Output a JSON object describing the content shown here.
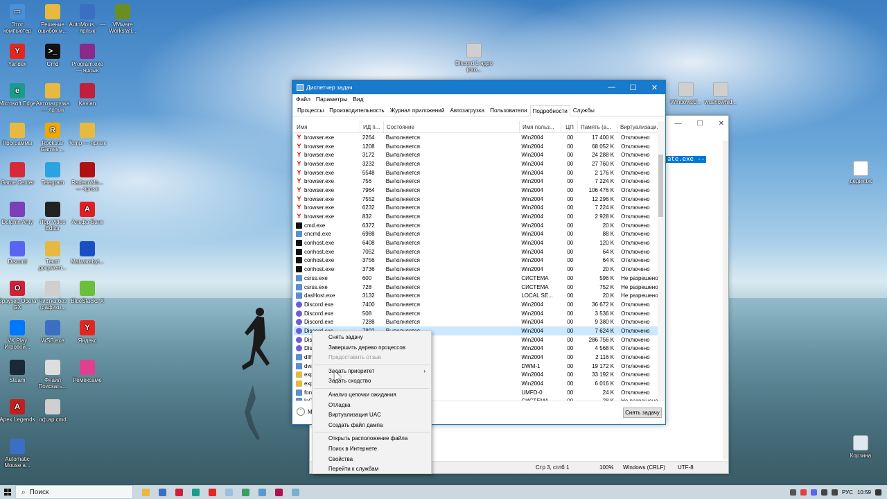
{
  "desktop_icons": [
    {
      "label": "Этот компьютер",
      "color": "#4a90d9",
      "glyph": "▭"
    },
    {
      "label": "Решение ошибок м...",
      "color": "#e8b940",
      "glyph": ""
    },
    {
      "label": "AutoMous... — ярлык",
      "color": "#3a6fc4",
      "glyph": ""
    },
    {
      "label": "VMware Workstati...",
      "color": "#6b8e23",
      "glyph": ""
    },
    {
      "label": "Yandex",
      "color": "#e52620",
      "glyph": "Y"
    },
    {
      "label": "Cmd",
      "color": "#111111",
      "glyph": ">_"
    },
    {
      "label": "Program.exe — ярлык",
      "color": "#8a2a8a",
      "glyph": ""
    },
    {
      "label": "Microsoft Edge",
      "color": "#1a9c8a",
      "glyph": "e"
    },
    {
      "label": "Автозагрузка — ярлык",
      "color": "#e8b940",
      "glyph": ""
    },
    {
      "label": "Kavian",
      "color": "#c0203a",
      "glyph": ""
    },
    {
      "label": "Программы",
      "color": "#e8b940",
      "glyph": ""
    },
    {
      "label": "Rockstar Games ...",
      "color": "#f0a800",
      "glyph": "R"
    },
    {
      "label": "Temp — ярлык",
      "color": "#e8b940",
      "glyph": ""
    },
    {
      "label": "Game Center",
      "color": "#d62a3a",
      "glyph": ""
    },
    {
      "label": "Telegram",
      "color": "#2aa3e0",
      "glyph": ""
    },
    {
      "label": "RadeonMo... — ярлык",
      "color": "#b01010",
      "glyph": ""
    },
    {
      "label": "Dolphin Anty",
      "color": "#7b3fb8",
      "glyph": ""
    },
    {
      "label": "iTop Video Editor",
      "color": "#222222",
      "glyph": ""
    },
    {
      "label": "Альфа-Банк",
      "color": "#e02020",
      "glyph": "A"
    },
    {
      "label": "Discord",
      "color": "#5865f2",
      "glyph": ""
    },
    {
      "label": "Текст документ...",
      "color": "#e8b940",
      "glyph": ""
    },
    {
      "label": "Malwarebyt...",
      "color": "#1a4fc4",
      "glyph": ""
    },
    {
      "label": "Браузер Opera GX",
      "color": "#d0203a",
      "glyph": "O"
    },
    {
      "label": "Чистка без графики...",
      "color": "#cfcfcf",
      "glyph": ""
    },
    {
      "label": "BlueStacks X",
      "color": "#6bbf3a",
      "glyph": ""
    },
    {
      "label": "VK Play Игровой...",
      "color": "#0077ff",
      "glyph": ""
    },
    {
      "label": "WSB.exe",
      "color": "#3a6fc4",
      "glyph": ""
    },
    {
      "label": "Яндекс",
      "color": "#e52620",
      "glyph": "Y"
    },
    {
      "label": "Steam",
      "color": "#1b2838",
      "glyph": ""
    },
    {
      "label": "Фнайл Поискать...",
      "color": "#dddddd",
      "glyph": ""
    },
    {
      "label": "Ремексаме",
      "color": "#e04090",
      "glyph": ""
    },
    {
      "label": "Apex Legends",
      "color": "#c02020",
      "glyph": "A"
    },
    {
      "label": "оф.ар.cmd",
      "color": "#cfcfcf",
      "glyph": ""
    },
    {
      "label": "Automatic Mouse a...",
      "color": "#3a6fc4",
      "glyph": ""
    }
  ],
  "right_icons": [
    {
      "label": "Discord 1 ядро (ско...",
      "color": "#cfcfcf"
    },
    {
      "label": "WindowsU...",
      "color": "#cfcfcf"
    },
    {
      "label": "wushowhid...",
      "color": "#cfcfcf"
    },
    {
      "label": "дедик.txt",
      "color": "#ffffff"
    },
    {
      "label": "Корзина",
      "color": "#dfe8ef"
    }
  ],
  "notepad": {
    "selected_text": "ate.exe --",
    "status": {
      "pos": "Стр 3, стлб 1",
      "zoom": "100%",
      "eol": "Windows (CRLF)",
      "enc": "UTF-8"
    }
  },
  "taskmgr": {
    "title": "Диспетчер задач",
    "menu": [
      "Файл",
      "Параметры",
      "Вид"
    ],
    "tabs": [
      "Процессы",
      "Производительность",
      "Журнал приложений",
      "Автозагрузка",
      "Пользователи",
      "Подробности",
      "Службы"
    ],
    "active_tab": "Подробности",
    "columns": {
      "name": "Имя",
      "pid": "ИД п...",
      "status": "Состояние",
      "user": "Имя польз...",
      "cpu": "ЦП",
      "mem": "Память (а...",
      "virt": "Виртуализаци..."
    },
    "rows": [
      {
        "icon": "yandex",
        "name": "browser.exe",
        "pid": "2264",
        "status": "Выполняется",
        "user": "Win2004",
        "cpu": "00",
        "mem": "17 400 K",
        "virt": "Отключено"
      },
      {
        "icon": "yandex",
        "name": "browser.exe",
        "pid": "1208",
        "status": "Выполняется",
        "user": "Win2004",
        "cpu": "00",
        "mem": "68 052 K",
        "virt": "Отключено"
      },
      {
        "icon": "yandex",
        "name": "browser.exe",
        "pid": "3172",
        "status": "Выполняется",
        "user": "Win2004",
        "cpu": "00",
        "mem": "24 288 K",
        "virt": "Отключено"
      },
      {
        "icon": "yandex",
        "name": "browser.exe",
        "pid": "3232",
        "status": "Выполняется",
        "user": "Win2004",
        "cpu": "00",
        "mem": "27 760 K",
        "virt": "Отключено"
      },
      {
        "icon": "yandex",
        "name": "browser.exe",
        "pid": "5548",
        "status": "Выполняется",
        "user": "Win2004",
        "cpu": "00",
        "mem": "2 176 K",
        "virt": "Отключено"
      },
      {
        "icon": "yandex",
        "name": "browser.exe",
        "pid": "756",
        "status": "Выполняется",
        "user": "Win2004",
        "cpu": "00",
        "mem": "7 224 K",
        "virt": "Отключено"
      },
      {
        "icon": "yandex",
        "name": "browser.exe",
        "pid": "7964",
        "status": "Выполняется",
        "user": "Win2004",
        "cpu": "00",
        "mem": "106 476 K",
        "virt": "Отключено"
      },
      {
        "icon": "yandex",
        "name": "browser.exe",
        "pid": "7552",
        "status": "Выполняется",
        "user": "Win2004",
        "cpu": "00",
        "mem": "12 296 K",
        "virt": "Отключено"
      },
      {
        "icon": "yandex",
        "name": "browser.exe",
        "pid": "6232",
        "status": "Выполняется",
        "user": "Win2004",
        "cpu": "00",
        "mem": "7 224 K",
        "virt": "Отключено"
      },
      {
        "icon": "yandex",
        "name": "browser.exe",
        "pid": "832",
        "status": "Выполняется",
        "user": "Win2004",
        "cpu": "00",
        "mem": "2 928 K",
        "virt": "Отключено"
      },
      {
        "icon": "cmd",
        "name": "cmd.exe",
        "pid": "6372",
        "status": "Выполняется",
        "user": "Win2004",
        "cpu": "00",
        "mem": "20 K",
        "virt": "Отключено"
      },
      {
        "icon": "sys",
        "name": "cncmd.exe",
        "pid": "6988",
        "status": "Выполняется",
        "user": "Win2004",
        "cpu": "00",
        "mem": "88 K",
        "virt": "Отключено"
      },
      {
        "icon": "cmd",
        "name": "conhost.exe",
        "pid": "6408",
        "status": "Выполняется",
        "user": "Win2004",
        "cpu": "00",
        "mem": "120 K",
        "virt": "Отключено"
      },
      {
        "icon": "cmd",
        "name": "conhost.exe",
        "pid": "7052",
        "status": "Выполняется",
        "user": "Win2004",
        "cpu": "00",
        "mem": "64 K",
        "virt": "Отключено"
      },
      {
        "icon": "cmd",
        "name": "conhost.exe",
        "pid": "3756",
        "status": "Выполняется",
        "user": "Win2004",
        "cpu": "00",
        "mem": "64 K",
        "virt": "Отключено"
      },
      {
        "icon": "cmd",
        "name": "conhost.exe",
        "pid": "3736",
        "status": "Выполняется",
        "user": "Win2004",
        "cpu": "00",
        "mem": "20 K",
        "virt": "Отключено"
      },
      {
        "icon": "sys",
        "name": "csrss.exe",
        "pid": "600",
        "status": "Выполняется",
        "user": "СИСТЕМА",
        "cpu": "00",
        "mem": "596 K",
        "virt": "Не разрешено"
      },
      {
        "icon": "sys",
        "name": "csrss.exe",
        "pid": "728",
        "status": "Выполняется",
        "user": "СИСТЕМА",
        "cpu": "00",
        "mem": "752 K",
        "virt": "Не разрешено"
      },
      {
        "icon": "sys",
        "name": "dasHost.exe",
        "pid": "3132",
        "status": "Выполняется",
        "user": "LOCAL SE...",
        "cpu": "00",
        "mem": "20 K",
        "virt": "Не разрешено"
      },
      {
        "icon": "discord",
        "name": "Discord.exe",
        "pid": "7400",
        "status": "Выполняется",
        "user": "Win2004",
        "cpu": "00",
        "mem": "36 672 K",
        "virt": "Отключено"
      },
      {
        "icon": "discord",
        "name": "Discord.exe",
        "pid": "508",
        "status": "Выполняется",
        "user": "Win2004",
        "cpu": "00",
        "mem": "3 536 K",
        "virt": "Отключено"
      },
      {
        "icon": "discord",
        "name": "Discord.exe",
        "pid": "7288",
        "status": "Выполняется",
        "user": "Win2004",
        "cpu": "00",
        "mem": "9 380 K",
        "virt": "Отключено"
      },
      {
        "icon": "discord",
        "name": "Discord.exe",
        "pid": "7892",
        "status": "Выполняется",
        "user": "Win2004",
        "cpu": "00",
        "mem": "7 624 K",
        "virt": "Отключено",
        "selected": true
      },
      {
        "icon": "discord",
        "name": "Discord.exe",
        "pid": "",
        "status": "",
        "user": "Win2004",
        "cpu": "00",
        "mem": "286 756 K",
        "virt": "Отключено"
      },
      {
        "icon": "discord",
        "name": "Discord.exe",
        "pid": "",
        "status": "",
        "user": "Win2004",
        "cpu": "00",
        "mem": "4 568 K",
        "virt": "Отключено"
      },
      {
        "icon": "sys",
        "name": "dllhost.exe",
        "pid": "",
        "status": "",
        "user": "Win2004",
        "cpu": "00",
        "mem": "2 116 K",
        "virt": "Отключено"
      },
      {
        "icon": "sys",
        "name": "dwm.exe",
        "pid": "",
        "status": "",
        "user": "DWM-1",
        "cpu": "00",
        "mem": "19 172 K",
        "virt": "Отключено"
      },
      {
        "icon": "folder",
        "name": "explorer.exe",
        "pid": "",
        "status": "",
        "user": "Win2004",
        "cpu": "00",
        "mem": "33 192 K",
        "virt": "Отключено"
      },
      {
        "icon": "folder",
        "name": "explorer.exe",
        "pid": "",
        "status": "",
        "user": "Win2004",
        "cpu": "00",
        "mem": "6 016 K",
        "virt": "Отключено"
      },
      {
        "icon": "sys",
        "name": "fontdrvhost.exe",
        "pid": "",
        "status": "",
        "user": "UMFD-0",
        "cpu": "00",
        "mem": "24 K",
        "virt": "Отключено"
      },
      {
        "icon": "sys",
        "name": "lpOverlay.exe",
        "pid": "",
        "status": "",
        "user": "СИСТЕМА",
        "cpu": "00",
        "mem": "28 K",
        "virt": "Не разрешено"
      }
    ],
    "bottom": {
      "less": "М",
      "end_task": "Снять задачу"
    }
  },
  "context_menu": {
    "groups": [
      [
        {
          "label": "Снять задачу"
        },
        {
          "label": "Завершить дерево процессов"
        },
        {
          "label": "Предоставить отзыв",
          "disabled": true
        }
      ],
      [
        {
          "label": "Задать приоритет",
          "submenu": true
        },
        {
          "label": "Задать сходство"
        }
      ],
      [
        {
          "label": "Анализ цепочки ожидания"
        },
        {
          "label": "Отладка"
        },
        {
          "label": "Виртуализация UAC"
        },
        {
          "label": "Создать файл дампа"
        }
      ],
      [
        {
          "label": "Открыть расположение файла"
        },
        {
          "label": "Поиск в Интернете"
        },
        {
          "label": "Свойства"
        },
        {
          "label": "Перейти к службам"
        }
      ]
    ]
  },
  "taskbar": {
    "search_placeholder": "Поиск",
    "apps": [
      "#e8b940",
      "#3a6fc4",
      "#d0203a",
      "#1a9c8a",
      "#e52620",
      "#9ac0e0",
      "#3aa060",
      "#5a9ad0",
      "#b01050",
      "#7ab0d0"
    ],
    "lang": "РУС",
    "time": "10:59"
  }
}
